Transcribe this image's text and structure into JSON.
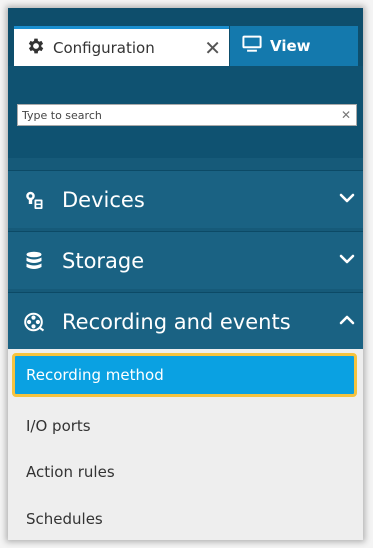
{
  "tabs": {
    "configuration": {
      "label": "Configuration",
      "close_glyph": "✕",
      "icon": "gear-icon"
    },
    "view": {
      "label": "View",
      "icon": "monitor-icon"
    }
  },
  "search": {
    "placeholder": "Type to search",
    "value": "",
    "clear_glyph": "✕"
  },
  "sections": {
    "devices": {
      "label": "Devices",
      "icon": "devices-icon",
      "state": "collapsed"
    },
    "storage": {
      "label": "Storage",
      "icon": "database-icon",
      "state": "collapsed"
    },
    "recording": {
      "label": "Recording and events",
      "icon": "film-reel-icon",
      "state": "expanded"
    }
  },
  "submenu": {
    "items": [
      "Recording method",
      "I/O ports",
      "Action rules",
      "Schedules"
    ],
    "selected": "Recording method"
  },
  "colors": {
    "header": "#0e4e6c",
    "section": "#1a6283",
    "active_tab": "#1479ad",
    "selected_item": "#0aa1e2",
    "highlight": "#f6c33e",
    "submenu_bg": "#eeeeee"
  }
}
